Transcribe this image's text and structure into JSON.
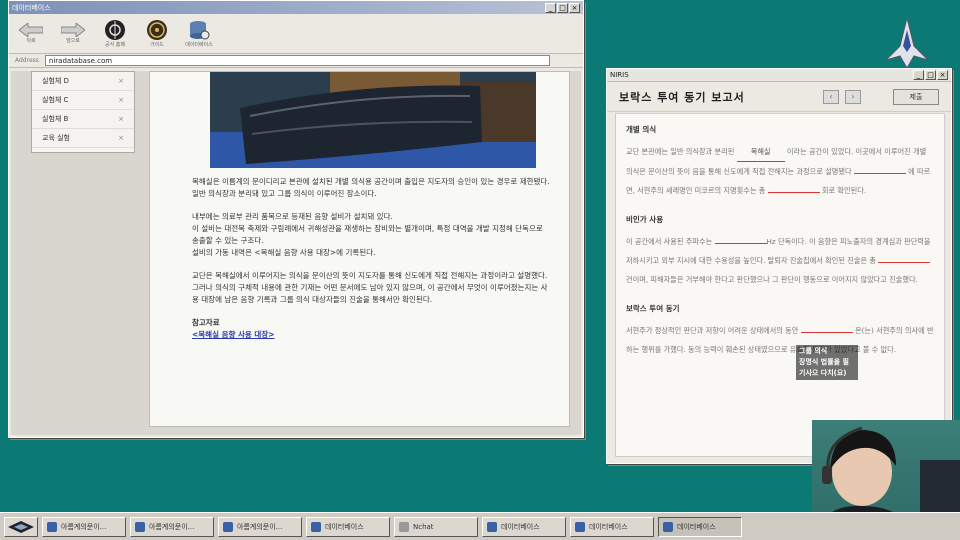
{
  "database_window": {
    "title": "데이터베이스",
    "toolbar": {
      "back_label": "뒤로",
      "forward_label": "앞으로",
      "btn1_label": "공식 홈페",
      "btn2_label": "가이드",
      "btn3_label": "데이터베이스"
    },
    "address_label": "Address",
    "address_value": "niradatabase.com",
    "side_items": [
      "실험체 D",
      "실험체 C",
      "실험체 B",
      "교육 실험"
    ],
    "document": {
      "paragraphs": [
        "목해실은 이름계의 문이디리교 본관에 설치된 개별 의식용 공간이며 출입은 지도자의 승인이 있는 경우로 제한됐다.\n일반 의식장과 분리돼 있고 그룹 의식이 이루어진 장소이다.",
        "내부에는 의료부 관리 품목으로 등재된 음향 설비가 설치돼 있다.\n이 설비는 대전복 축제와 구림례에서 귀해성관을 재생하는 장비와는 별개이며, 특정 대역을 개발 지정해 단독으로 송출할 수 있는 구조다.\n설비의 가동 내역은 <목해실 음향 사용 대장>에 기록된다.",
        "교단은 목해실에서 이루어지는 의식을 문이산의 뜻이 지도자를 통해 신도에게 직접 전해지는 과정이라고 설명했다.\n그러나 의식의 구체적 내용에 관한 기재는 어떤 문서에도 남아 있지 않으며, 이 공간에서 무엇이 이루어졌는지는 사용 대장에 남은 음향 기록과 그룹 의식 대상자들의 진술을 통해서만 확인된다."
      ],
      "ref_title": "참고자료",
      "ref_link": "<목해실 음향 사용 대장>"
    }
  },
  "niris_window": {
    "title": "NIRIS",
    "report_title": "보락스 투여 동기 보고서",
    "prev": "‹",
    "next": "›",
    "submit_label": "제출",
    "sections": [
      {
        "heading": "개별 의식",
        "parts": [
          "교단 본관에는 일반 의식장과 분리된 ",
          "목해실",
          " 이라는 공간이 있었다. 이곳에서 이루어진 개별 의식은 문이산의 뜻이 음을 통해 신도에게 직접 전해지는 과정으로 설명됐다 ",
          "",
          " 에 따르면, 서현주의 세레명인 미코르의 지명횟수는 총 ",
          "",
          " 회로 확인된다."
        ]
      },
      {
        "heading": "비인가 사용",
        "parts": [
          "이 공간에서 사용된 주파수는 ",
          "",
          "Hz 단독이다. 이 음향은 피노출자의 경계심과 판단력을 저하시키고 외부 지시에 대한 수용성을 높인다. 탈퇴자 진술집에서 확인된 진술은 총 ",
          "",
          " 건이며, 피해자들은 거부해야 한다고 판단했으나 그 판단이 행동으로 이어지지 않았다고 진술했다."
        ]
      },
      {
        "heading": "보락스 투여 동기",
        "parts": [
          "서현주가 정상적인 판단과 저항이 어려운 상태에서의 동안 ",
          "",
          " 온(는) 서현주의 의사에 반하는 행위를 가했다. 동의 능력이 훼손된 상태였으므로 유효한 동의가 있었다고 볼 수 없다."
        ]
      }
    ]
  },
  "subtitle_overlay": "그룹 의식\n장명식 법률을 필기사으 다치(요)",
  "taskbar": {
    "items": [
      {
        "label": "아름계의문이...",
        "active": false
      },
      {
        "label": "아름계의문이...",
        "active": false
      },
      {
        "label": "아름계의문이...",
        "active": false
      },
      {
        "label": "데이터베이스",
        "active": false
      },
      {
        "label": "Nchat",
        "active": false
      },
      {
        "label": "데이터베이스",
        "active": false
      },
      {
        "label": "데이터베이스",
        "active": false
      },
      {
        "label": "데이터베이스",
        "active": true
      }
    ]
  },
  "colors": {
    "desktop": "#0b7a74",
    "link": "#2a3aa8",
    "blank_line": "#dd3333"
  }
}
